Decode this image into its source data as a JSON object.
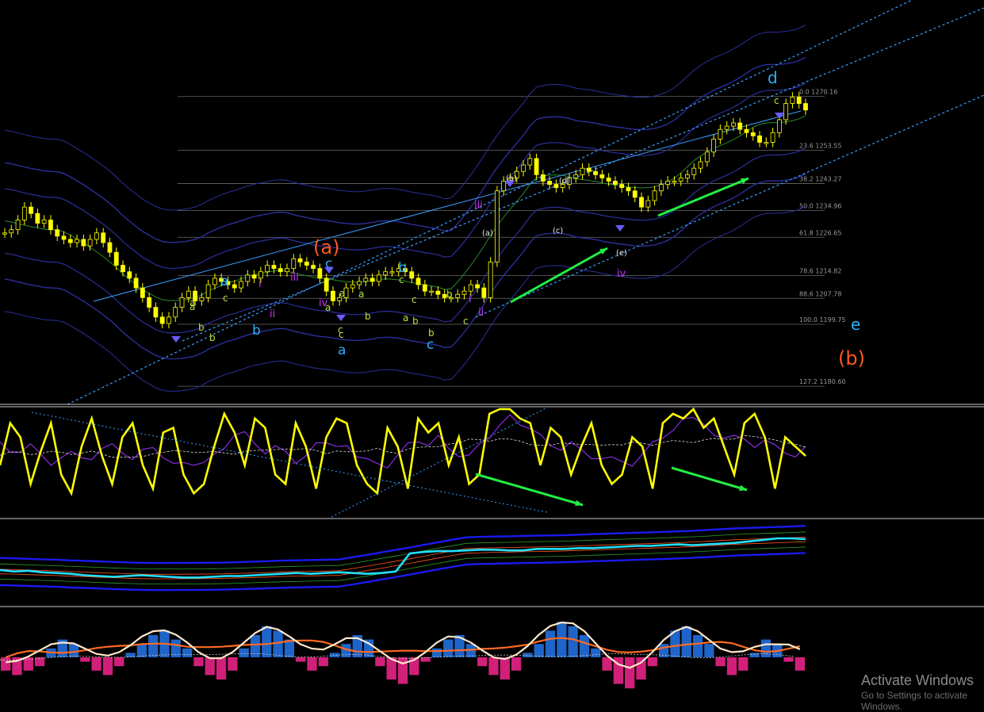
{
  "colors": {
    "background": "#000000",
    "panel_separator": "#c8c8c8",
    "candle": "#ffff00",
    "fib_line": "#6a6a6a",
    "fib_text": "#9a9a9a",
    "channel_line": "#3aa0ff",
    "bollinger": "#2b2f9c",
    "oscillator_main": "#ffff00",
    "oscillator_signal": "#8a2be2",
    "arrow_green": "#22ee44",
    "wave_cyan": "#2ab0ff",
    "wave_orange": "#ff5a1a",
    "wave_magenta": "#cc33ff",
    "wave_lime": "#b8e040",
    "wave_white": "#e8e8e8",
    "hist_pos": "#1f64c8",
    "hist_neg": "#d0207a",
    "macd_line": "#ffe8c8",
    "macd_signal": "#ff6a20",
    "momentum_cyan": "#22e0ff",
    "momentum_band": "#1a1aee"
  },
  "fib_levels": [
    {
      "pct": "0.0",
      "price": "1270.16"
    },
    {
      "pct": "23.6",
      "price": "1253.55"
    },
    {
      "pct": "38.2",
      "price": "1243.27"
    },
    {
      "pct": "50.0",
      "price": "1234.96"
    },
    {
      "pct": "61.8",
      "price": "1226.65"
    },
    {
      "pct": "78.6",
      "price": "1214.82"
    },
    {
      "pct": "88.6",
      "price": "1207.78"
    },
    {
      "pct": "100.0",
      "price": "1199.75"
    },
    {
      "pct": "127.2",
      "price": "1180.60"
    }
  ],
  "wave_labels": [
    {
      "text": "(a)",
      "role": "orange_big"
    },
    {
      "text": "(b)",
      "role": "orange_big"
    },
    {
      "text": "d",
      "role": "cyan_big"
    },
    {
      "text": "e",
      "role": "cyan_big"
    },
    {
      "text": "a",
      "role": "cyan"
    },
    {
      "text": "b",
      "role": "cyan"
    },
    {
      "text": "c",
      "role": "cyan"
    },
    {
      "text": "a",
      "role": "cyan"
    },
    {
      "text": "b",
      "role": "cyan"
    },
    {
      "text": "c",
      "role": "cyan"
    },
    {
      "text": "iii",
      "role": "magenta"
    },
    {
      "text": "iv",
      "role": "magenta"
    },
    {
      "text": "i",
      "role": "magenta"
    },
    {
      "text": "ii",
      "role": "magenta"
    },
    {
      "text": "iii",
      "role": "magenta"
    },
    {
      "text": "iv",
      "role": "magenta"
    },
    {
      "text": "i",
      "role": "magenta"
    },
    {
      "text": "ii",
      "role": "magenta"
    },
    {
      "text": "(a)",
      "role": "white"
    },
    {
      "text": "(b)",
      "role": "white"
    },
    {
      "text": "(c)",
      "role": "white"
    },
    {
      "text": "(d)",
      "role": "white"
    },
    {
      "text": "(e)",
      "role": "white"
    },
    {
      "text": "c",
      "role": "lime"
    },
    {
      "text": "a",
      "role": "lime"
    },
    {
      "text": "b",
      "role": "lime"
    },
    {
      "text": "c",
      "role": "lime"
    },
    {
      "text": "a",
      "role": "lime"
    },
    {
      "text": "b",
      "role": "lime"
    },
    {
      "text": "a",
      "role": "lime"
    },
    {
      "text": "b",
      "role": "lime"
    },
    {
      "text": "c",
      "role": "lime"
    },
    {
      "text": "b",
      "role": "lime"
    },
    {
      "text": "c",
      "role": "lime"
    },
    {
      "text": "a",
      "role": "lime"
    },
    {
      "text": "b",
      "role": "lime"
    },
    {
      "text": "c",
      "role": "lime"
    },
    {
      "text": "b",
      "role": "lime"
    },
    {
      "text": "a",
      "role": "lime"
    },
    {
      "text": "c",
      "role": "lime"
    },
    {
      "text": "a",
      "role": "lime"
    },
    {
      "text": "c",
      "role": "lime"
    }
  ],
  "chart_data": [
    {
      "type": "candlestick",
      "title": "",
      "series": [
        {
          "values": [
            1228,
            1229,
            1232,
            1236,
            1234,
            1231,
            1232,
            1229,
            1227,
            1226,
            1225,
            1226,
            1224,
            1226,
            1228,
            1225,
            1222,
            1218,
            1216,
            1214,
            1211,
            1208,
            1205,
            1202,
            1200,
            1202,
            1205,
            1208,
            1210,
            1207,
            1208,
            1212,
            1214,
            1213,
            1212,
            1211,
            1213,
            1215,
            1214,
            1216,
            1218,
            1217,
            1216,
            1217,
            1220,
            1219,
            1218,
            1217,
            1214,
            1210,
            1207,
            1208,
            1211,
            1212,
            1213,
            1214,
            1213,
            1215,
            1216,
            1216,
            1217,
            1216,
            1214,
            1212,
            1210,
            1210,
            1209,
            1208,
            1208,
            1209,
            1210,
            1212,
            1211,
            1208,
            1219,
            1241,
            1244,
            1245,
            1247,
            1249,
            1251,
            1246,
            1244,
            1243,
            1242,
            1243,
            1245,
            1246,
            1248,
            1247,
            1246,
            1245,
            1244,
            1243,
            1242,
            1241,
            1239,
            1236,
            1238,
            1241,
            1243,
            1244,
            1244,
            1245,
            1246,
            1248,
            1250,
            1253,
            1257,
            1260,
            1261,
            1262,
            1260,
            1259,
            1258,
            1256,
            1256,
            1259,
            1263,
            1268,
            1270,
            1268,
            1266
          ]
        }
      ],
      "fib_levels": [
        1270.16,
        1253.55,
        1243.27,
        1234.96,
        1226.65,
        1214.82,
        1207.78,
        1199.75,
        1180.6
      ],
      "ylim": [
        1175,
        1300
      ]
    },
    {
      "type": "line",
      "title": "",
      "series": [
        {
          "values": [
            40,
            85,
            70,
            20,
            55,
            85,
            30,
            10,
            60,
            90,
            50,
            20,
            70,
            85,
            40,
            15,
            75,
            80,
            30,
            10,
            20,
            60,
            95,
            75,
            40,
            90,
            80,
            30,
            20,
            85,
            60,
            15,
            70,
            90,
            85,
            40,
            20,
            10,
            80,
            60,
            15,
            90,
            75,
            85,
            40,
            70,
            20,
            30,
            95,
            100,
            100,
            90,
            85,
            40,
            80,
            70,
            30,
            60,
            85,
            40,
            20,
            30,
            70,
            60,
            15,
            85,
            95,
            90,
            100,
            80,
            90,
            60,
            30,
            85,
            95,
            70,
            15,
            70,
            60,
            50
          ]
        }
      ],
      "ylim": [
        0,
        100
      ]
    },
    {
      "type": "line",
      "title": "",
      "series": [
        {
          "values": [
            38,
            36,
            37,
            35,
            34,
            33,
            31,
            30,
            29,
            30,
            31,
            30,
            29,
            28,
            28,
            29,
            30,
            30,
            31,
            32,
            33,
            34,
            33,
            34,
            35,
            34,
            33,
            34,
            36,
            60,
            62,
            63,
            63,
            64,
            65,
            65,
            64,
            64,
            66,
            66,
            66,
            67,
            67,
            68,
            69,
            70,
            70,
            71,
            72,
            71,
            72,
            73,
            74,
            76,
            78,
            80,
            80,
            79
          ]
        }
      ],
      "ylim": [
        0,
        100
      ]
    },
    {
      "type": "bar",
      "title": "",
      "series": [
        {
          "values": [
            -3,
            -4,
            -3,
            -2,
            2,
            4,
            3,
            -1,
            -3,
            -4,
            -2,
            1,
            3,
            5,
            6,
            4,
            2,
            -2,
            -4,
            -5,
            -3,
            2,
            5,
            7,
            6,
            4,
            -1,
            -3,
            -2,
            1,
            3,
            5,
            4,
            -2,
            -5,
            -6,
            -4,
            -1,
            2,
            4,
            5,
            3,
            -2,
            -4,
            -5,
            -3,
            1,
            3,
            6,
            8,
            7,
            5,
            2,
            -3,
            -6,
            -7,
            -5,
            -2,
            3,
            6,
            7,
            5,
            3,
            -2,
            -4,
            -3,
            1,
            4,
            3,
            -1,
            -3
          ]
        }
      ],
      "ylim": [
        -10,
        10
      ]
    }
  ],
  "watermark": {
    "title": "Activate Windows",
    "subtitle": "Go to Settings to activate Windows."
  }
}
